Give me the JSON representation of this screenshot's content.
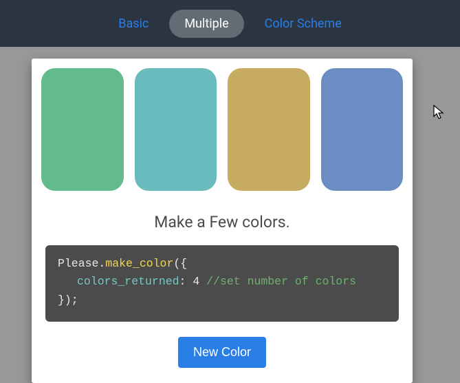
{
  "tabs": {
    "basic": "Basic",
    "multiple": "Multiple",
    "scheme": "Color Scheme",
    "active": "multiple"
  },
  "swatches": {
    "colors": [
      "#63bb8d",
      "#69bcbd",
      "#c6ab61",
      "#6a8dc4"
    ]
  },
  "heading": "Make a Few colors.",
  "code": {
    "obj": "Please",
    "dot": ".",
    "fn": "make_color",
    "open": "({",
    "key": "colors_returned",
    "colon": ": ",
    "value": "4",
    "space": " ",
    "comment": "//set number of colors",
    "close": "});"
  },
  "button": "New Color"
}
